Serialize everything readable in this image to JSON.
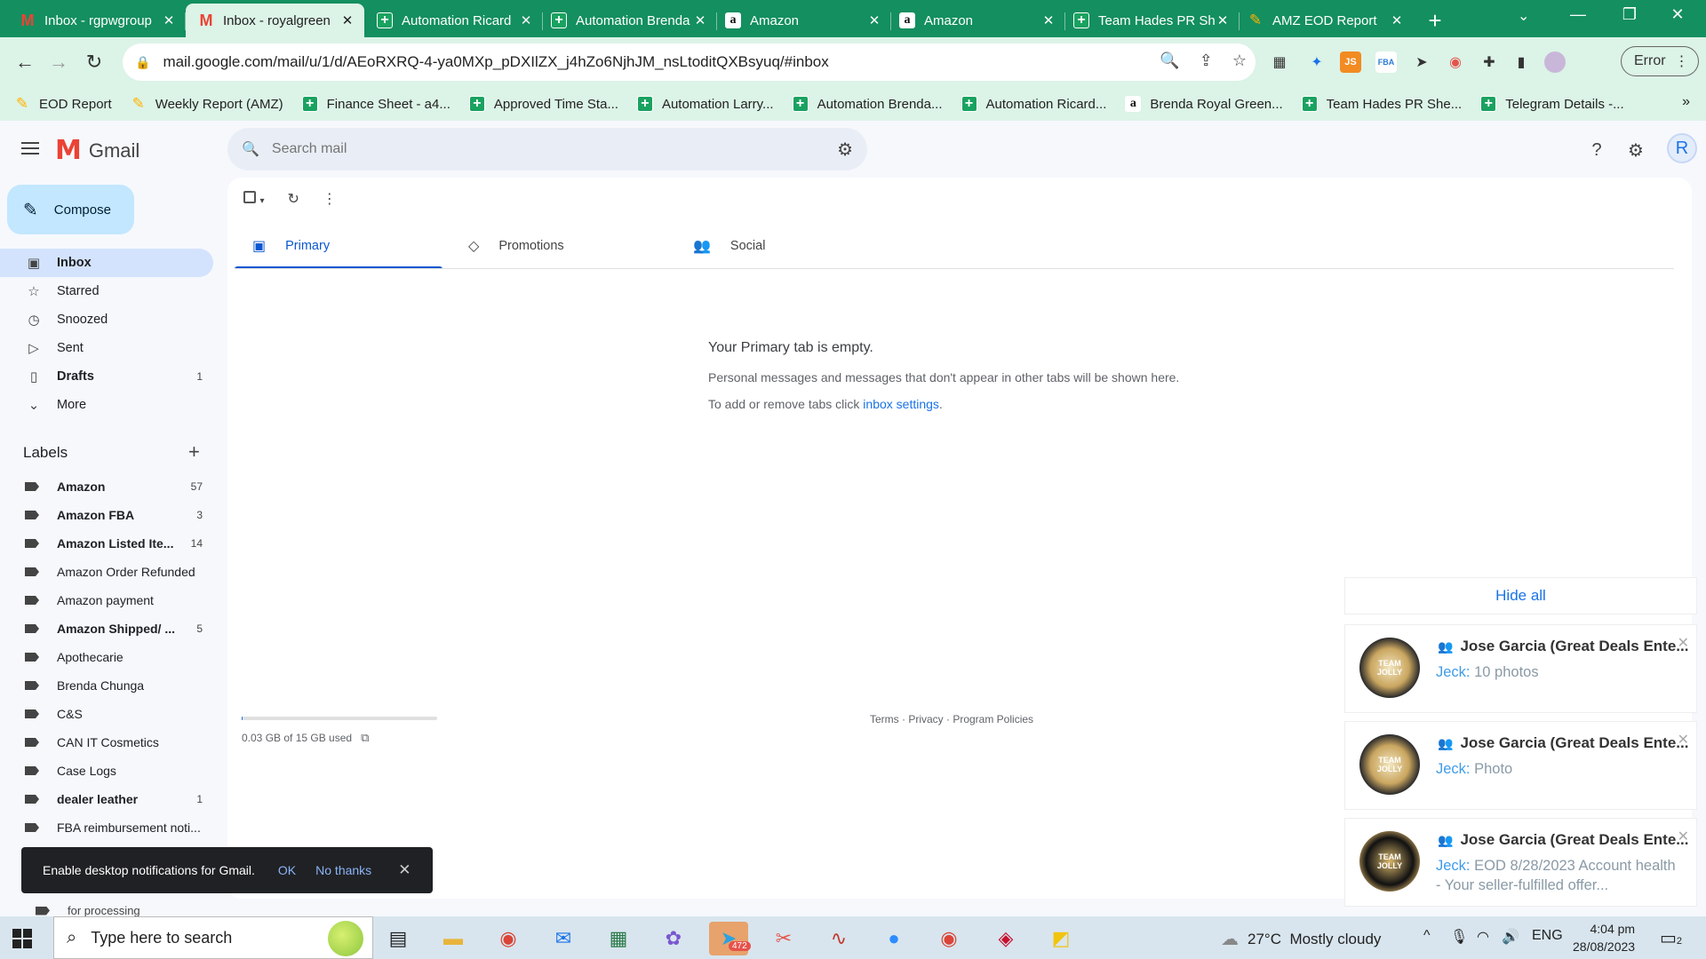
{
  "browser": {
    "tabs": [
      {
        "title": "Inbox - rgpwgroup",
        "favicon": "gmail-icon",
        "active": false
      },
      {
        "title": "Inbox - royalgreen",
        "favicon": "gmail-icon",
        "active": true
      },
      {
        "title": "Automation Ricard",
        "favicon": "sheets-icon",
        "active": false
      },
      {
        "title": "Automation Brenda",
        "favicon": "sheets-icon",
        "active": false
      },
      {
        "title": "Amazon",
        "favicon": "amazon-icon",
        "active": false
      },
      {
        "title": "Amazon",
        "favicon": "amazon-icon",
        "active": false
      },
      {
        "title": "Team Hades PR Sh",
        "favicon": "sheets-icon",
        "active": false
      },
      {
        "title": "AMZ EOD Report",
        "favicon": "amz-report-icon",
        "active": false
      }
    ],
    "url": "mail.google.com/mail/u/1/d/AEoRXRQ-4-ya0MXp_pDXIlZX_j4hZo6NjhJM_nsLtoditQXBsyuq/#inbox",
    "profile_status": "Error",
    "bookmarks": [
      {
        "label": "EOD Report",
        "icon": "amz-report-icon"
      },
      {
        "label": "Weekly Report (AMZ)",
        "icon": "amz-report-icon"
      },
      {
        "label": "Finance Sheet - a4...",
        "icon": "sheets-icon"
      },
      {
        "label": "Approved Time Sta...",
        "icon": "sheets-icon"
      },
      {
        "label": "Automation Larry...",
        "icon": "sheets-icon"
      },
      {
        "label": "Automation Brenda...",
        "icon": "sheets-icon"
      },
      {
        "label": "Automation Ricard...",
        "icon": "sheets-icon"
      },
      {
        "label": "Brenda Royal Green...",
        "icon": "amazon-icon"
      },
      {
        "label": "Team Hades PR She...",
        "icon": "sheets-icon"
      },
      {
        "label": "Telegram Details -...",
        "icon": "sheets-icon"
      }
    ]
  },
  "gmail": {
    "brand": "Gmail",
    "search_placeholder": "Search mail",
    "compose_label": "Compose",
    "nav": [
      {
        "label": "Inbox",
        "icon": "inbox-icon",
        "count": "",
        "active": true,
        "bold": true
      },
      {
        "label": "Starred",
        "icon": "star-icon",
        "count": "",
        "active": false,
        "bold": false
      },
      {
        "label": "Snoozed",
        "icon": "clock-icon",
        "count": "",
        "active": false,
        "bold": false
      },
      {
        "label": "Sent",
        "icon": "send-icon",
        "count": "",
        "active": false,
        "bold": false
      },
      {
        "label": "Drafts",
        "icon": "draft-icon",
        "count": "1",
        "active": false,
        "bold": true
      },
      {
        "label": "More",
        "icon": "chevron-down-icon",
        "count": "",
        "active": false,
        "bold": false
      }
    ],
    "labels_title": "Labels",
    "labels": [
      {
        "label": "Amazon",
        "count": "57",
        "bold": true
      },
      {
        "label": "Amazon FBA",
        "count": "3",
        "bold": true
      },
      {
        "label": "Amazon Listed Ite...",
        "count": "14",
        "bold": true
      },
      {
        "label": "Amazon Order Refunded",
        "count": "",
        "bold": false
      },
      {
        "label": "Amazon payment",
        "count": "",
        "bold": false
      },
      {
        "label": "Amazon Shipped/ ...",
        "count": "5",
        "bold": true
      },
      {
        "label": "Apothecarie",
        "count": "",
        "bold": false
      },
      {
        "label": "Brenda Chunga",
        "count": "",
        "bold": false
      },
      {
        "label": "C&S",
        "count": "",
        "bold": false
      },
      {
        "label": "CAN IT Cosmetics",
        "count": "",
        "bold": false
      },
      {
        "label": "Case Logs",
        "count": "",
        "bold": false
      },
      {
        "label": "dealer leather",
        "count": "1",
        "bold": true
      },
      {
        "label": "FBA reimbursement noti...",
        "count": "",
        "bold": false
      }
    ],
    "partial_label": "for processing",
    "category_tabs": [
      {
        "label": "Primary",
        "icon": "inbox-icon",
        "active": true
      },
      {
        "label": "Promotions",
        "icon": "tag-icon",
        "active": false
      },
      {
        "label": "Social",
        "icon": "people-icon",
        "active": false
      }
    ],
    "empty": {
      "heading": "Your Primary tab is empty.",
      "line1": "Personal messages and messages that don't appear in other tabs will be shown here.",
      "line2_prefix": "To add or remove tabs click ",
      "line2_link": "inbox settings",
      "line2_suffix": "."
    },
    "storage": "0.03 GB of 15 GB used",
    "storage_used_fraction": 0.002,
    "footer": "Terms · Privacy · Program Policies",
    "snackbar": {
      "text": "Enable desktop notifications for Gmail.",
      "ok": "OK",
      "no": "No thanks"
    }
  },
  "notifications": {
    "hide_all": "Hide all",
    "items": [
      {
        "name": "Jose Garcia (Great Deals Ente...",
        "sender": "Jeck:",
        "message": "10 photos"
      },
      {
        "name": "Jose Garcia (Great Deals Ente...",
        "sender": "Jeck:",
        "message": "Photo"
      },
      {
        "name": "Jose Garcia (Great Deals Ente...",
        "sender": "Jeck:",
        "message": "EOD 8/28/2023 Account health - Your seller-fulfilled offer..."
      }
    ]
  },
  "taskbar": {
    "search_placeholder": "Type here to search",
    "telegram_badge": "472",
    "weather_temp": "27°C",
    "weather_desc": "Mostly cloudy",
    "language": "ENG",
    "time": "4:04 pm",
    "date": "28/08/2023",
    "notif_count": "2"
  }
}
